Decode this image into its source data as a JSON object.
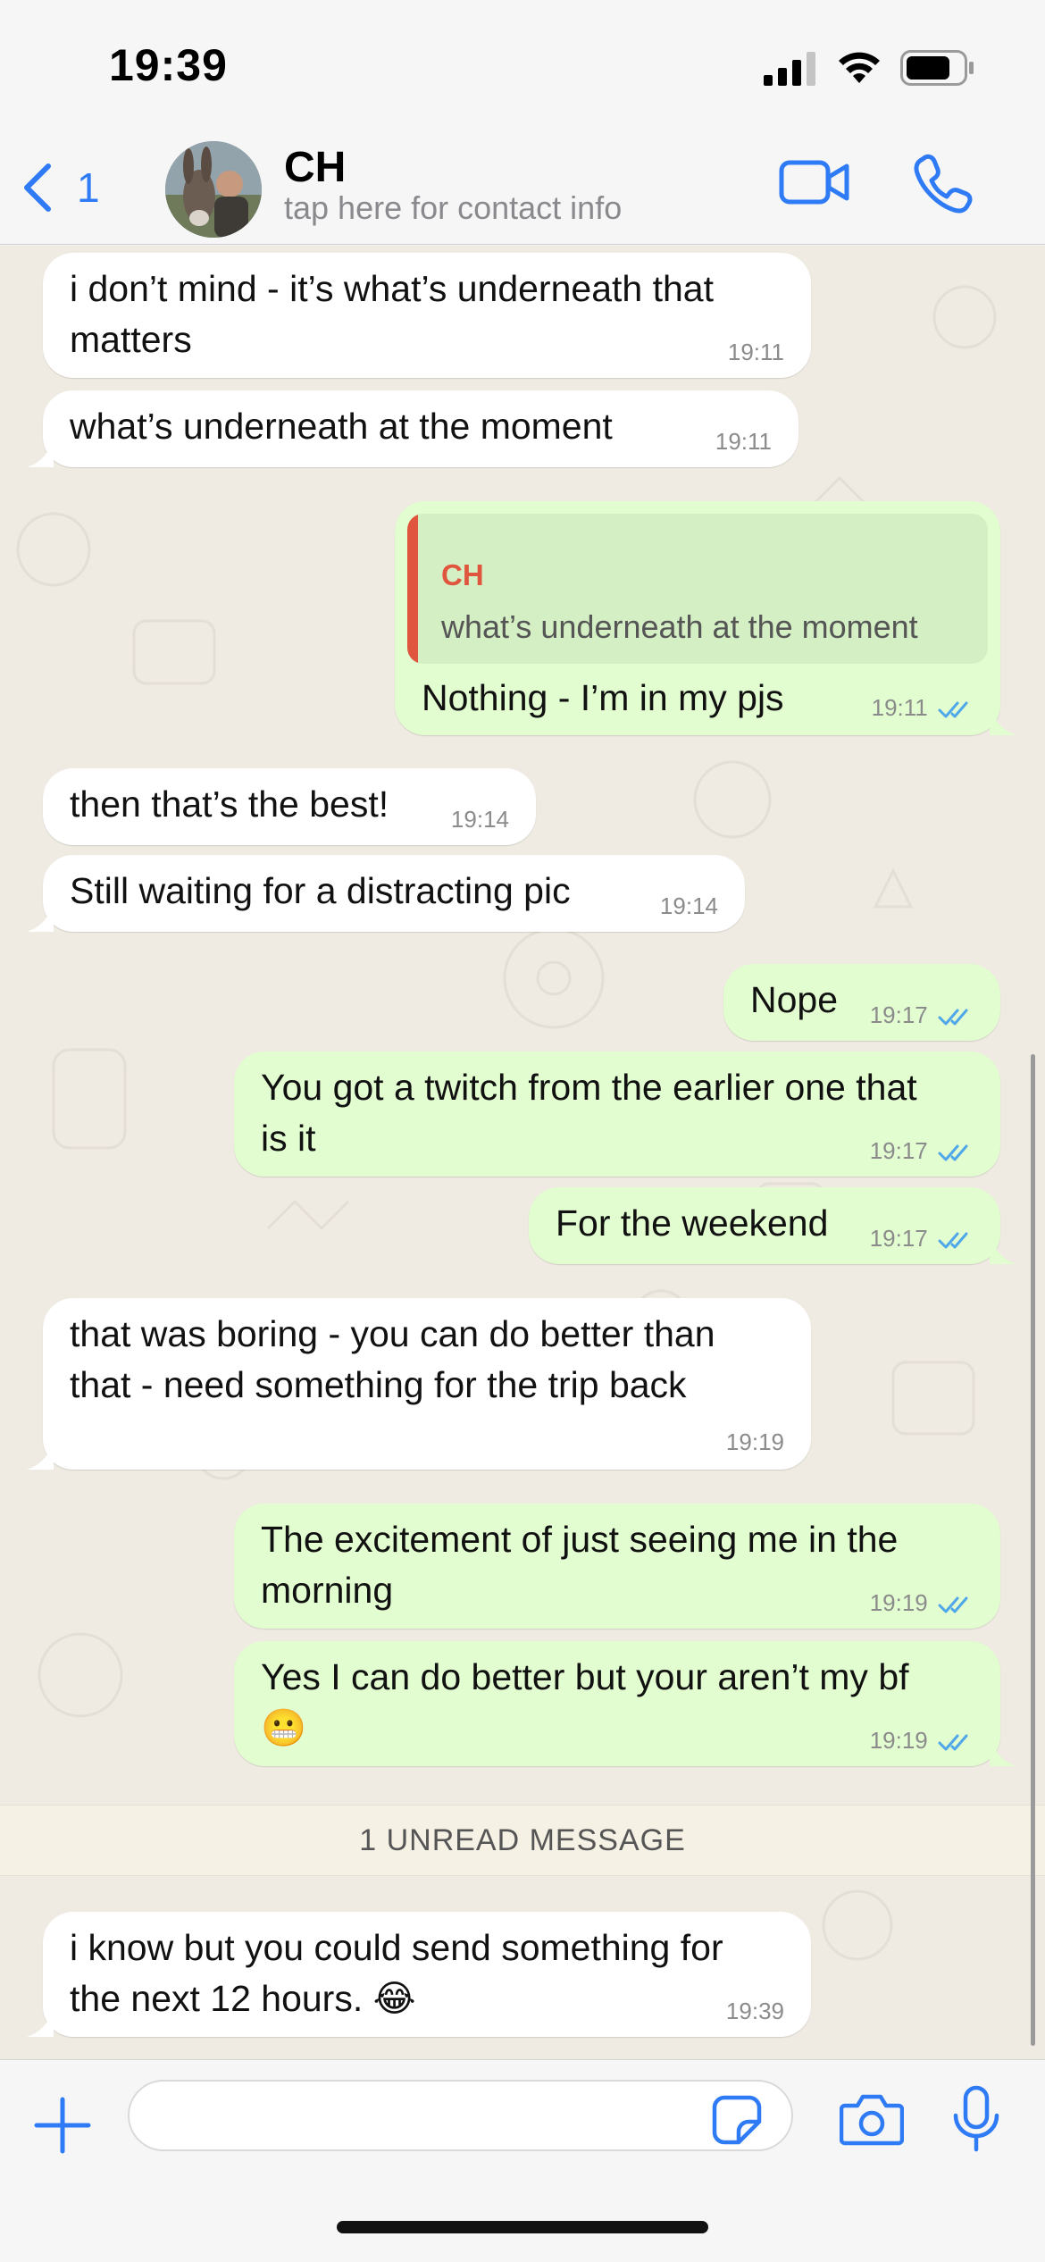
{
  "status_bar": {
    "time": "19:39"
  },
  "header": {
    "back_count": "1",
    "contact_name": "CH",
    "contact_subtitle": "tap here for contact info"
  },
  "messages": [
    {
      "dir": "in",
      "text_lines": [
        "i don’t mind - it’s what’s underneath that",
        "matters"
      ],
      "time": "19:11"
    },
    {
      "dir": "in",
      "text_lines": [
        "what’s underneath at the moment"
      ],
      "time": "19:11"
    },
    {
      "dir": "out",
      "quote": {
        "author": "CH",
        "text": "what’s underneath at the moment"
      },
      "text_lines": [
        "Nothing - I’m in my pjs"
      ],
      "time": "19:11"
    },
    {
      "dir": "in",
      "text_lines": [
        "then that’s the best!"
      ],
      "time": "19:14"
    },
    {
      "dir": "in",
      "text_lines": [
        "Still waiting for a distracting pic"
      ],
      "time": "19:14"
    },
    {
      "dir": "out",
      "text_lines": [
        "Nope"
      ],
      "time": "19:17"
    },
    {
      "dir": "out",
      "text_lines": [
        "You got a twitch from the earlier one that",
        "is it"
      ],
      "time": "19:17"
    },
    {
      "dir": "out",
      "text_lines": [
        "For the weekend"
      ],
      "time": "19:17"
    },
    {
      "dir": "in",
      "text_lines": [
        "that was boring - you can do better than",
        "that - need something for the trip back"
      ],
      "time": "19:19"
    },
    {
      "dir": "out",
      "text_lines": [
        "The excitement of just seeing me in the",
        "morning"
      ],
      "time": "19:19"
    },
    {
      "dir": "out",
      "text_lines": [
        "Yes I can do better but your aren’t my bf",
        "😬"
      ],
      "time": "19:19"
    },
    {
      "dir": "in",
      "text_lines": [
        "i know but you could send something for",
        "the next 12 hours. 😂"
      ],
      "time": "19:39"
    }
  ],
  "unread_divider": "1 UNREAD MESSAGE",
  "input": {
    "value": ""
  },
  "colors": {
    "accent": "#2f7bf5",
    "outgoing_bubble": "#e2fdd0",
    "incoming_bubble": "#ffffff",
    "quote_author": "#e0553e",
    "read_ticks": "#4fa6e8"
  },
  "icons": [
    "back-chevron-icon",
    "video-call-icon",
    "phone-call-icon",
    "plus-icon",
    "sticker-icon",
    "camera-icon",
    "microphone-icon"
  ]
}
